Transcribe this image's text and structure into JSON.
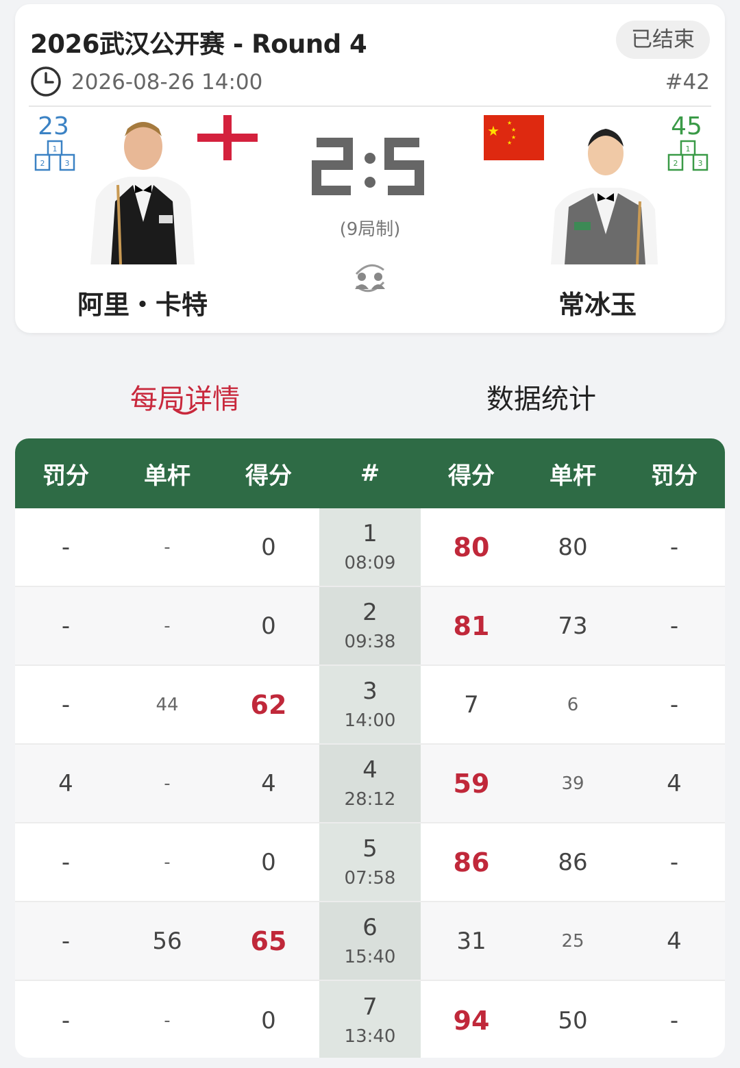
{
  "match": {
    "title": "2026武汉公开赛 - Round 4",
    "status": "已结束",
    "datetime": "2026-08-26 14:00",
    "match_no": "#42",
    "score_display": "2:5",
    "frames_format": "(9局制)",
    "colors": {
      "win": "#c0283a",
      "header_green": "#2e6b45",
      "tab_active": "#c8283c"
    }
  },
  "player_left": {
    "name": "阿里・卡特",
    "rank": "23",
    "flag": "england-flag",
    "rank_color": "#3b82c4",
    "score": "2"
  },
  "player_right": {
    "name": "常冰玉",
    "rank": "45",
    "flag": "china-flag",
    "rank_color": "#3a9a47",
    "score": "5"
  },
  "tabs": [
    {
      "label": "每局详情",
      "active": true
    },
    {
      "label": "数据统计",
      "active": false
    }
  ],
  "table": {
    "headers": [
      "罚分",
      "单杆",
      "得分",
      "#",
      "得分",
      "单杆",
      "罚分"
    ],
    "rows": [
      {
        "l_pen": "-",
        "l_brk": "-",
        "l_score": "0",
        "frame": "1",
        "time": "08:09",
        "r_score": "80",
        "r_brk": "80",
        "r_pen": "-",
        "winner": "right"
      },
      {
        "l_pen": "-",
        "l_brk": "-",
        "l_score": "0",
        "frame": "2",
        "time": "09:38",
        "r_score": "81",
        "r_brk": "73",
        "r_pen": "-",
        "winner": "right"
      },
      {
        "l_pen": "-",
        "l_brk": "44",
        "l_score": "62",
        "frame": "3",
        "time": "14:00",
        "r_score": "7",
        "r_brk": "6",
        "r_pen": "-",
        "winner": "left"
      },
      {
        "l_pen": "4",
        "l_brk": "-",
        "l_score": "4",
        "frame": "4",
        "time": "28:12",
        "r_score": "59",
        "r_brk": "39",
        "r_pen": "4",
        "winner": "right"
      },
      {
        "l_pen": "-",
        "l_brk": "-",
        "l_score": "0",
        "frame": "5",
        "time": "07:58",
        "r_score": "86",
        "r_brk": "86",
        "r_pen": "-",
        "winner": "right"
      },
      {
        "l_pen": "-",
        "l_brk": "56",
        "l_score": "65",
        "frame": "6",
        "time": "15:40",
        "r_score": "31",
        "r_brk": "25",
        "r_pen": "4",
        "winner": "left"
      },
      {
        "l_pen": "-",
        "l_brk": "-",
        "l_score": "0",
        "frame": "7",
        "time": "13:40",
        "r_score": "94",
        "r_brk": "50",
        "r_pen": "-",
        "winner": "right"
      }
    ]
  }
}
